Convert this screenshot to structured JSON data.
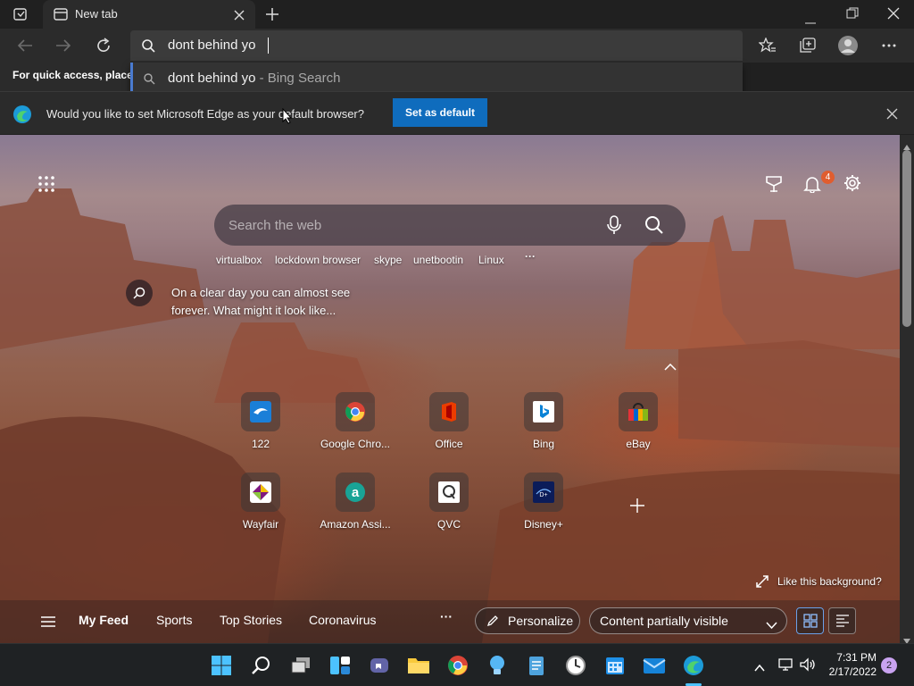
{
  "window": {
    "tab_title": "New tab"
  },
  "address": {
    "query": "dont behind yo"
  },
  "suggestion": {
    "query": "dont behind yo",
    "source": " - Bing Search"
  },
  "favorites_hint": "For quick access, place y",
  "infobar": {
    "message": "Would you like to set Microsoft Edge as your default browser?",
    "button": "Set as default"
  },
  "newtab": {
    "search_placeholder": "Search the web",
    "chips": [
      "virtualbox",
      "lockdown browser",
      "skype",
      "unetbootin",
      "Linux"
    ],
    "fact": "On a clear day you can almost see forever. What might it look like...",
    "notification_count": "4",
    "tiles_row1": [
      "122",
      "Google Chro...",
      "Office",
      "Bing",
      "eBay"
    ],
    "tiles_row2": [
      "Wayfair",
      "Amazon Assi...",
      "QVC",
      "Disney+"
    ],
    "like_background": "Like this background?",
    "feed_tabs": [
      "My Feed",
      "Sports",
      "Top Stories",
      "Coronavirus"
    ],
    "personalize": "Personalize",
    "content_visibility": "Content partially visible"
  },
  "taskbar": {
    "time": "7:31 PM",
    "date": "2/17/2022",
    "notifications": "2"
  },
  "colors": {
    "accent": "#0f6cbd",
    "badge": "#e05d2f",
    "notif_badge": "#c9a3f0"
  }
}
